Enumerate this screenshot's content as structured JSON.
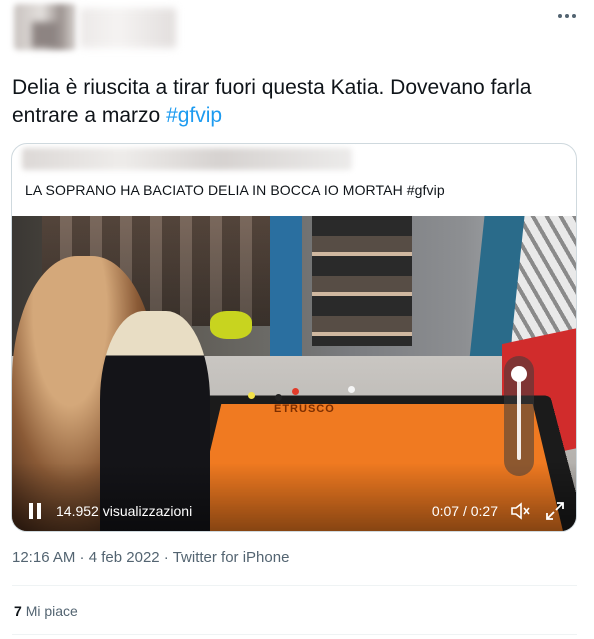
{
  "tweet": {
    "text": "Delia è riuscita a tirar fuori questa Katia. Dovevano farla entrare a marzo ",
    "hashtag": "#gfvip"
  },
  "quoted_tweet": {
    "text": "LA SOPRANO HA BACIATO DELIA IN BOCCA IO MORTAH #gfvip"
  },
  "video": {
    "views": "14.952 visualizzazioni",
    "time": "0:07 / 0:27",
    "table_logo": "ETRUSCO"
  },
  "meta": {
    "time": "12:16 AM",
    "sep": " · ",
    "date": "4 feb 2022",
    "source": "Twitter for iPhone"
  },
  "likes": {
    "count": "7",
    "label": "Mi piace"
  },
  "icons": [
    "more-icon",
    "pause-icon",
    "volume-icon",
    "fullscreen-icon"
  ]
}
